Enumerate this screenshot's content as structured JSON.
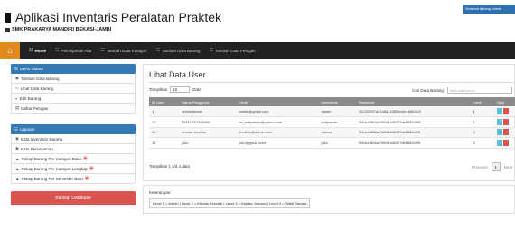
{
  "header": {
    "title": "Aplikasi Inventaris Peralatan Praktek",
    "subtitle": "SMK PRAKARYA MANDIRI BEKASI-JAMBI",
    "user_box": "Selamat datang Admin"
  },
  "navbar": {
    "items": [
      {
        "icon": "☷",
        "label": "Home"
      },
      {
        "icon": "☷",
        "label": "Peminjaman Alat"
      },
      {
        "icon": "☷",
        "label": "Tambah Data Kategori"
      },
      {
        "icon": "☷",
        "label": "Tambah Data Barang"
      },
      {
        "icon": "☷",
        "label": "Tambah Data Petugas"
      }
    ]
  },
  "sidebar": {
    "menu_title": "Menu Utama",
    "menu_items": [
      {
        "icon": "◉",
        "label": "Tambah Data Barang"
      },
      {
        "icon": "↻",
        "label": "Lihat Data Barang"
      },
      {
        "icon": "◐",
        "label": "Edit Barang"
      },
      {
        "icon": "▤",
        "label": "Daftar Petugas"
      }
    ],
    "report_title": "Laporan",
    "report_items": [
      {
        "icon": "◉",
        "label": "Data Inventaris Barang"
      },
      {
        "icon": "◉",
        "label": "Data Peminjaman"
      },
      {
        "icon": "▲",
        "label": "Rekap Barang Per Kategori Baku"
      },
      {
        "icon": "▲",
        "label": "Rekap Barang Per Kategori Lengkap"
      },
      {
        "icon": "▲",
        "label": "Rekap Barang Per Semester Baru"
      }
    ],
    "backup_button": "Backup Database"
  },
  "main": {
    "title": "Lihat Data User",
    "length_prefix": "Tampilkan",
    "length_value": "10",
    "length_suffix": "Data",
    "search_label": "Cari Data Barang:",
    "search_placeholder": "ketik kata kunci",
    "columns": [
      "ID User",
      "Nama Pengguna",
      "Email",
      "Username",
      "Password",
      "Level",
      "Opsi"
    ],
    "rows": [
      [
        "1",
        "administrator",
        "admin@gmail.com",
        "admin",
        "21232f297a57a5a743894a0e4a801fc3",
        "1"
      ],
      [
        "10",
        "DIAN SETIAWAN",
        "ns_setiyawan@yahoo.com",
        "setiyawan",
        "5f4dcc3b5aa765d61d8327deb882cf99",
        "1"
      ],
      [
        "11",
        "ahmad sholihin",
        "sholihin@admin.com",
        "ahmad",
        "5f4dcc3b5aa765d61d8327deb882cf99",
        "2"
      ],
      [
        "12",
        "joko",
        "joko@gmail.com",
        "joko",
        "5f4dcc3b5aa765d61d8327deb882cf99",
        "2"
      ]
    ],
    "info": "Tampilkan 1 s/d 4 data",
    "pager_prev": "Previous",
    "pager_page": "1",
    "pager_next": "Next"
  },
  "legend": {
    "title": "Keterangan:",
    "text": "Level 1 = Admin | Level 2 = Kepala Sekolah | Level 3 = Kepala Jurusan | Level 4 = Wakil Sarana"
  }
}
